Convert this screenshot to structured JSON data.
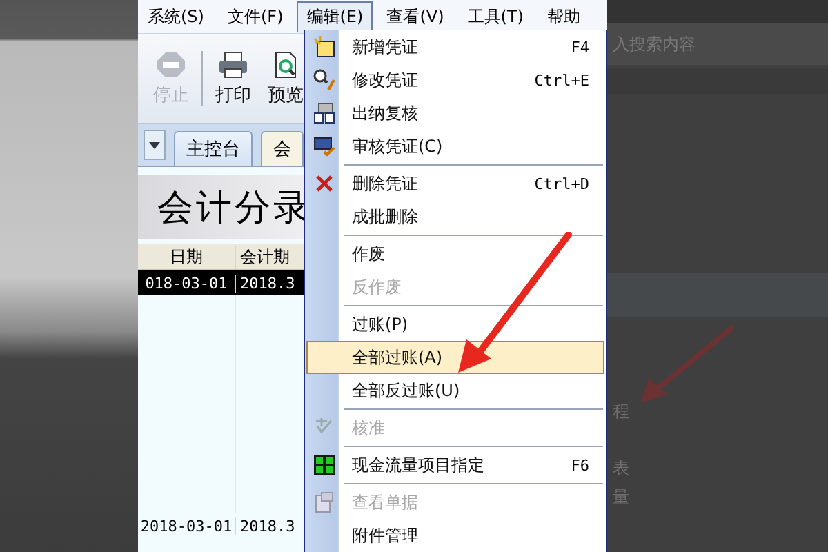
{
  "menubar": [
    {
      "label": "系统(S)",
      "selected": false
    },
    {
      "label": "文件(F)",
      "selected": false
    },
    {
      "label": "编辑(E)",
      "selected": true
    },
    {
      "label": "查看(V)",
      "selected": false
    },
    {
      "label": "工具(T)",
      "selected": false
    },
    {
      "label": "帮助",
      "selected": false
    }
  ],
  "toolbar": [
    {
      "label": "停止",
      "kind": "stop",
      "disabled": true
    },
    {
      "label": "打印",
      "kind": "print",
      "disabled": false
    },
    {
      "label": "预览",
      "kind": "preview",
      "disabled": false
    }
  ],
  "tabs": [
    {
      "label": "主控台",
      "selected": false
    },
    {
      "label": "会",
      "selected": true
    }
  ],
  "title": "会计分录",
  "table": {
    "columns": [
      "日期",
      "会计期"
    ],
    "rows": [
      {
        "cells": [
          "018-03-01",
          "2018.3"
        ],
        "selected": true
      },
      {
        "cells": [
          "2018-03-01",
          "2018.3"
        ],
        "selected": false
      }
    ]
  },
  "menu": [
    {
      "kind": "new",
      "label": "新增凭证",
      "shortcut": "F4",
      "disabled": false,
      "highlighted": false
    },
    {
      "kind": "edit",
      "label": "修改凭证",
      "shortcut": "Ctrl+E",
      "disabled": false,
      "highlighted": false
    },
    {
      "kind": "cashier",
      "label": "出纳复核",
      "disabled": false,
      "highlighted": false
    },
    {
      "kind": "audit",
      "label": "审核凭证(C)",
      "disabled": false,
      "highlighted": false
    },
    {
      "kind": "separator"
    },
    {
      "kind": "delete",
      "label": "删除凭证",
      "shortcut": "Ctrl+D",
      "disabled": false,
      "highlighted": false
    },
    {
      "kind": "plain",
      "label": "成批删除",
      "disabled": false,
      "highlighted": false
    },
    {
      "kind": "separator"
    },
    {
      "kind": "plain",
      "label": "作废",
      "disabled": false,
      "highlighted": false
    },
    {
      "kind": "plain",
      "label": "反作废",
      "disabled": true,
      "highlighted": false
    },
    {
      "kind": "separator"
    },
    {
      "kind": "plain",
      "label": "过账(P)",
      "disabled": false,
      "highlighted": false
    },
    {
      "kind": "plain",
      "label": "全部过账(A)",
      "disabled": false,
      "highlighted": true
    },
    {
      "kind": "plain",
      "label": "全部反过账(U)",
      "disabled": false,
      "highlighted": false
    },
    {
      "kind": "separator"
    },
    {
      "kind": "approve",
      "label": "核准",
      "disabled": true,
      "highlighted": false
    },
    {
      "kind": "separator"
    },
    {
      "kind": "grid",
      "label": "现金流量项目指定",
      "shortcut": "F6",
      "disabled": false,
      "highlighted": false
    },
    {
      "kind": "separator"
    },
    {
      "kind": "doc",
      "label": "查看单据",
      "disabled": true,
      "highlighted": false
    },
    {
      "kind": "plain",
      "label": "附件管理",
      "disabled": false,
      "highlighted": false
    }
  ],
  "background": {
    "search_placeholder": "入搜索内容",
    "side_texts": [
      "程",
      "表",
      "量"
    ]
  }
}
